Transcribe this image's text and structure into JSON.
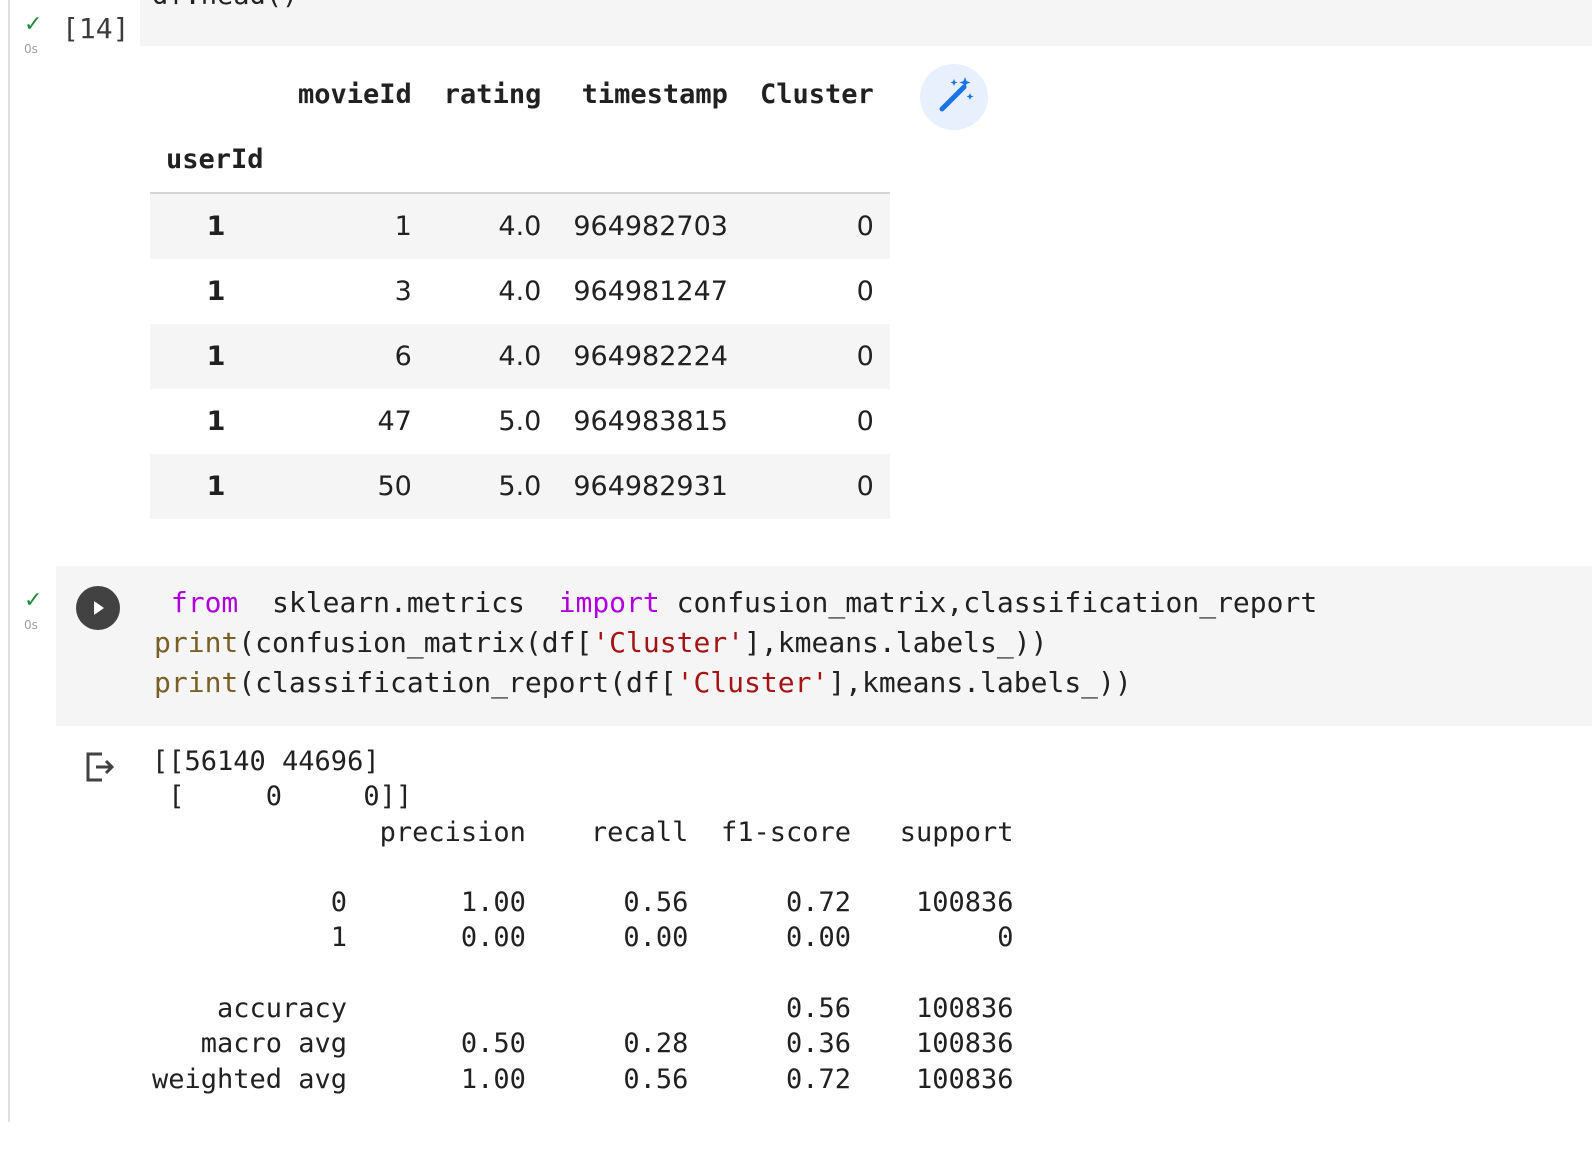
{
  "prev_cell": {
    "code": "df.head()",
    "exec_count": "[14]",
    "status_icon": "check-icon",
    "duration": "0s"
  },
  "dataframe": {
    "columns": [
      "movieId",
      "rating",
      "timestamp",
      "Cluster"
    ],
    "index_name": "userId",
    "rows": [
      {
        "userId": "1",
        "movieId": "1",
        "rating": "4.0",
        "timestamp": "964982703",
        "Cluster": "0"
      },
      {
        "userId": "1",
        "movieId": "3",
        "rating": "4.0",
        "timestamp": "964981247",
        "Cluster": "0"
      },
      {
        "userId": "1",
        "movieId": "6",
        "rating": "4.0",
        "timestamp": "964982224",
        "Cluster": "0"
      },
      {
        "userId": "1",
        "movieId": "47",
        "rating": "5.0",
        "timestamp": "964983815",
        "Cluster": "0"
      },
      {
        "userId": "1",
        "movieId": "50",
        "rating": "5.0",
        "timestamp": "964982931",
        "Cluster": "0"
      }
    ],
    "suggest_icon": "magic-wand-icon"
  },
  "code_cell": {
    "status_icon": "check-icon",
    "duration": "0s",
    "run_icon": "play-icon",
    "line1": {
      "kw1": "from",
      "mod": "sklearn.metrics",
      "kw2": "import",
      "names": "confusion_matrix,classification_report"
    },
    "line2": {
      "fn": "print",
      "a": "(confusion_matrix(df[",
      "s": "'Cluster'",
      "b": "],kmeans.labels_))"
    },
    "line3": {
      "fn": "print",
      "a": "(classification_report(df[",
      "s": "'Cluster'",
      "b": "],kmeans.labels_))"
    }
  },
  "output": {
    "icon": "output-icon",
    "text": "[[56140 44696]\n [     0     0]]\n              precision    recall  f1-score   support\n\n           0       1.00      0.56      0.72    100836\n           1       0.00      0.00      0.00         0\n\n    accuracy                           0.56    100836\n   macro avg       0.50      0.28      0.36    100836\nweighted avg       1.00      0.56      0.72    100836"
  }
}
